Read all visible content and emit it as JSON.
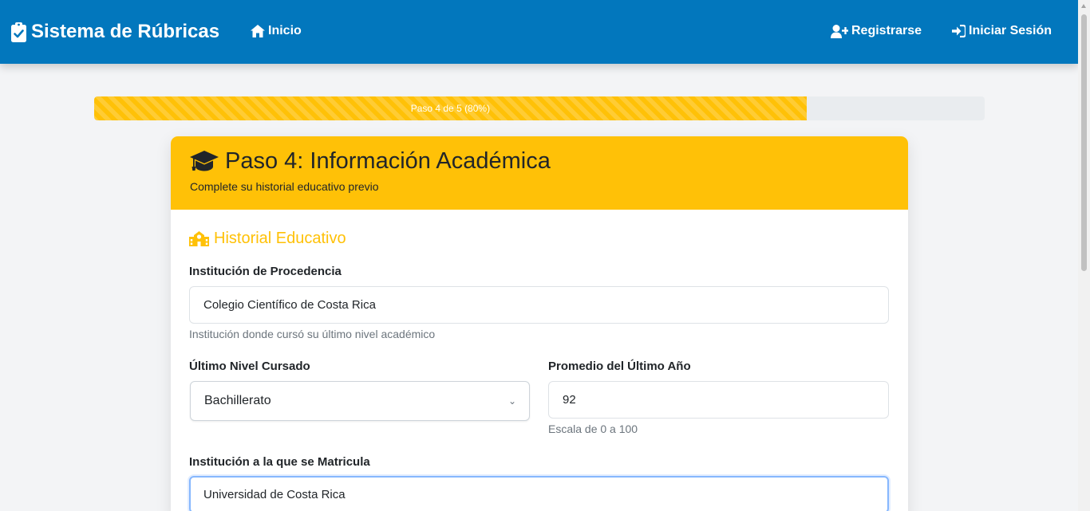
{
  "nav": {
    "brand": "Sistema de Rúbricas",
    "home": "Inicio",
    "register": "Registrarse",
    "login": "Iniciar Sesión"
  },
  "progress": {
    "label": "Paso 4 de 5 (80%)",
    "value": 0.8
  },
  "card": {
    "title": "Paso 4: Información Académica",
    "subtitle": "Complete su historial educativo previo"
  },
  "section": {
    "title": "Historial Educativo"
  },
  "form": {
    "origin": {
      "label": "Institución de Procedencia",
      "value": "Colegio Científico de Costa Rica",
      "help": "Institución donde cursó su último nivel académico"
    },
    "last_level": {
      "label": "Último Nivel Cursado",
      "value": "Bachillerato"
    },
    "average": {
      "label": "Promedio del Último Año",
      "value": "92",
      "help": "Escala de 0 a 100"
    },
    "enroll": {
      "label": "Institución a la que se Matricula",
      "value": "Universidad de Costa Rica"
    }
  },
  "colors": {
    "navbar": "#0277bd",
    "accent": "#ffc107",
    "background": "#f3f4f6"
  },
  "icons": [
    "clipboard-check-icon",
    "home-icon",
    "user-plus-icon",
    "sign-in-icon",
    "graduation-cap-icon",
    "school-icon",
    "chevron-down-icon"
  ]
}
